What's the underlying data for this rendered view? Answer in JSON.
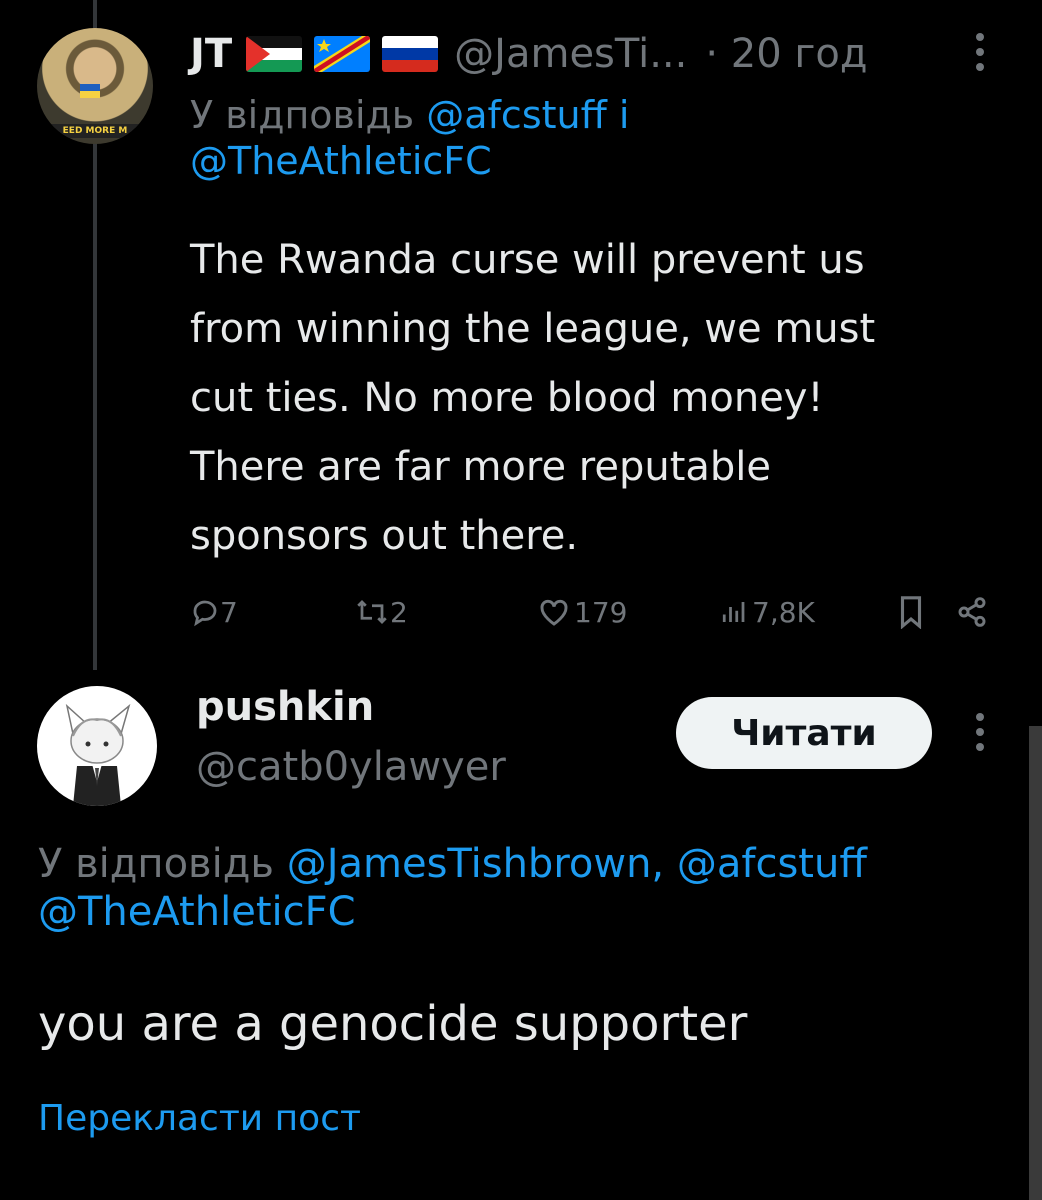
{
  "tweet1": {
    "author_name": "JT",
    "flags": [
      "palestine-flag",
      "dr-congo-flag",
      "russia-flag"
    ],
    "handle": "@JamesTi...",
    "time": "· 20 год",
    "avatar_banner": "EED MORE M",
    "reply_prefix": "У відповідь ",
    "reply_mention_1": "@afcstuff i",
    "reply_mention_2": "@TheAthleticFC",
    "text_lines": [
      "The Rwanda curse will prevent us",
      "from winning the league, we must",
      "cut ties. No more blood money!",
      "There are far more reputable",
      "sponsors out there."
    ],
    "stats": {
      "replies": "7",
      "retweets": "2",
      "likes": "179",
      "views": "7,8K"
    }
  },
  "tweet2": {
    "author_name": "pushkin",
    "handle": "@catb0ylawyer",
    "follow_label": "Читати",
    "reply_prefix": "У відповідь ",
    "reply_mentions_line1": "@JamesTishbrown, @afcstuff",
    "reply_mentions_line2": "@TheAthleticFC",
    "text": "you are a genocide supporter",
    "translate_label": "Перекласти пост"
  },
  "colors": {
    "background": "#000000",
    "text_primary": "#e7e9ea",
    "text_secondary": "#71767b",
    "accent": "#1d9bf0",
    "button_bg": "#eff3f4"
  }
}
